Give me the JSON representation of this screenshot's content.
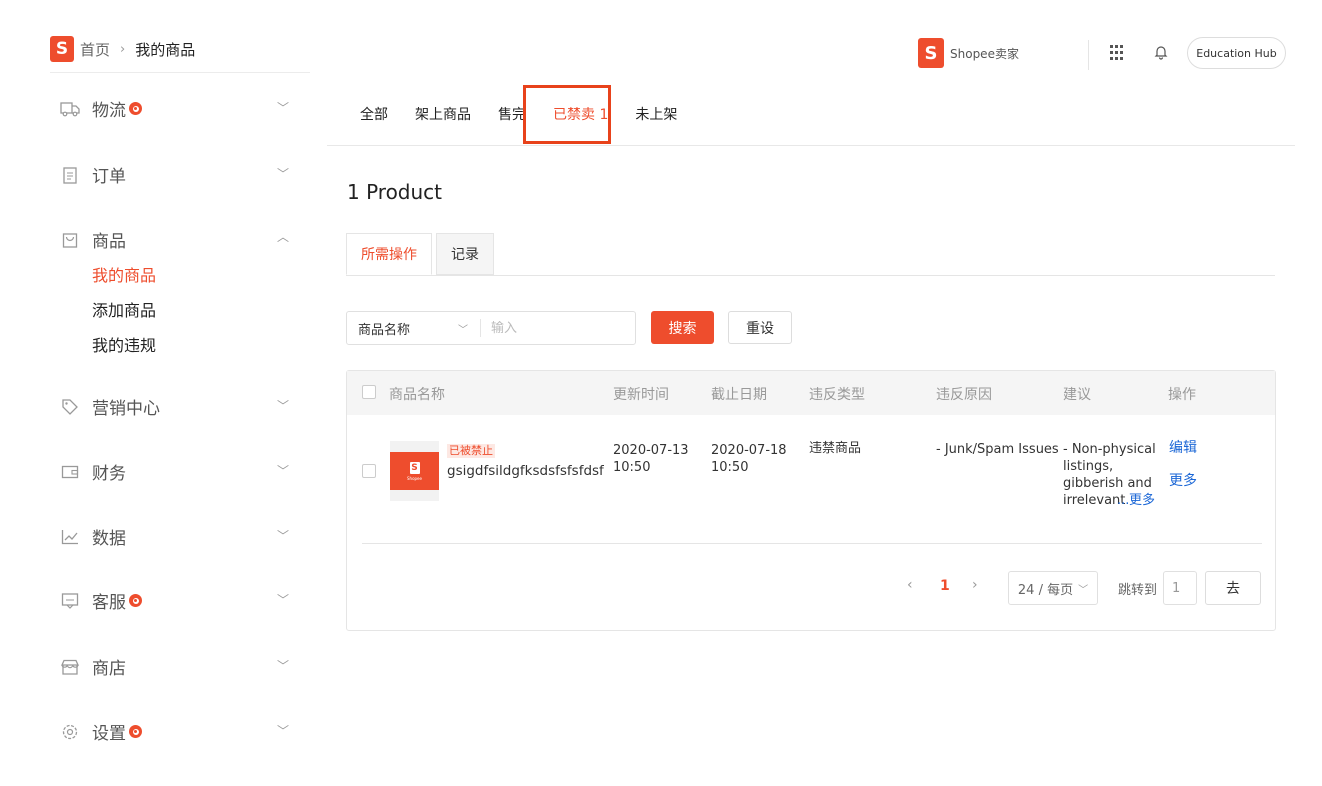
{
  "header": {
    "breadcrumb_home": "首页",
    "breadcrumb_sep": "›",
    "breadcrumb_current": "我的商品",
    "brand_text": "Shopee卖家",
    "logo_letter": "S",
    "education_hub": "Education Hub"
  },
  "sidebar": {
    "items": [
      {
        "label": "物流",
        "badge": true,
        "icon": "truck-icon",
        "expanded": false
      },
      {
        "label": "订单",
        "badge": false,
        "icon": "clipboard-icon",
        "expanded": false
      },
      {
        "label": "商品",
        "badge": false,
        "icon": "bag-icon",
        "expanded": true
      },
      {
        "label": "营销中心",
        "badge": false,
        "icon": "tag-icon",
        "expanded": false
      },
      {
        "label": "财务",
        "badge": false,
        "icon": "wallet-icon",
        "expanded": false
      },
      {
        "label": "数据",
        "badge": false,
        "icon": "chart-icon",
        "expanded": false
      },
      {
        "label": "客服",
        "badge": true,
        "icon": "chat-icon",
        "expanded": false
      },
      {
        "label": "商店",
        "badge": false,
        "icon": "store-icon",
        "expanded": false
      },
      {
        "label": "设置",
        "badge": true,
        "icon": "gear-icon",
        "expanded": false
      }
    ],
    "sub_items": [
      {
        "label": "我的商品",
        "active": true
      },
      {
        "label": "添加商品",
        "active": false
      },
      {
        "label": "我的违规",
        "active": false
      }
    ]
  },
  "main_tabs": [
    {
      "label": "全部",
      "active": false
    },
    {
      "label": "架上商品",
      "active": false
    },
    {
      "label": "售完",
      "active": false
    },
    {
      "label": "已禁卖 1",
      "active": true
    },
    {
      "label": "未上架",
      "active": false
    }
  ],
  "product_count": "1 Product",
  "sub_tabs": [
    {
      "label": "所需操作",
      "active": true
    },
    {
      "label": "记录",
      "active": false
    }
  ],
  "search": {
    "field_select": "商品名称",
    "placeholder": "输入",
    "search_label": "搜索",
    "reset_label": "重设"
  },
  "table": {
    "headers": [
      "商品名称",
      "更新时间",
      "截止日期",
      "违反类型",
      "违反原因",
      "建议",
      "操作"
    ],
    "rows": [
      {
        "status_tag": "已被禁止",
        "name": "gsigdfsildgfksdsfsfsfdsf",
        "updated_date": "2020-07-13",
        "updated_time": "10:50",
        "deadline_date": "2020-07-18",
        "deadline_time": "10:50",
        "violation_type": "违禁商品",
        "violation_reason": "- Junk/Spam Issues",
        "suggestion_lines": [
          "- Non-physical",
          "listings,",
          "gibberish and",
          "irrelevant"
        ],
        "suggestion_ellipsis": "...",
        "suggestion_more": "更多",
        "action_edit": "编辑",
        "action_more": "更多",
        "thumb_text": "Shopee"
      }
    ]
  },
  "pagination": {
    "prev": "‹",
    "current_page": "1",
    "next": "›",
    "per_page": "24 / 每页",
    "jump_label": "跳转到",
    "jump_value": "1",
    "go_label": "去"
  },
  "colors": {
    "accent": "#ee4d2d",
    "link": "#1a66d6"
  }
}
